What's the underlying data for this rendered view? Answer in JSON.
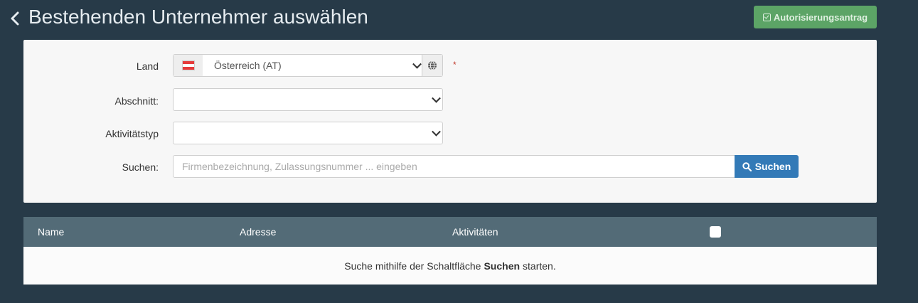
{
  "header": {
    "title": "Bestehenden Unternehmer auswählen",
    "auth_button_label": "Autorisierungsantrag"
  },
  "form": {
    "land_label": "Land",
    "land_value": "Österreich (AT)",
    "required_marker": "*",
    "abschnitt_label": "Abschnitt:",
    "abschnitt_value": "",
    "aktivitaet_label": "Aktivitätstyp",
    "aktivitaet_value": "",
    "suchen_label": "Suchen:",
    "search_placeholder": "Firmenbezeichnung, Zulassungsnummer ... eingeben",
    "search_button_label": "Suchen"
  },
  "table": {
    "columns": [
      "Name",
      "Adresse",
      "Aktivitäten"
    ],
    "empty_prefix": "Suche mithilfe der Schaltfläche",
    "empty_bold": "Suchen",
    "empty_suffix": "starten."
  },
  "colors": {
    "background": "#273a48",
    "accent_green": "#5ca466",
    "accent_blue": "#337ab7",
    "table_header": "#536b77"
  },
  "icons": {
    "back": "chevron-left-icon",
    "auth": "checkbox-check-icon",
    "flag": "austria-flag-icon",
    "globe": "globe-icon",
    "search": "search-icon"
  }
}
